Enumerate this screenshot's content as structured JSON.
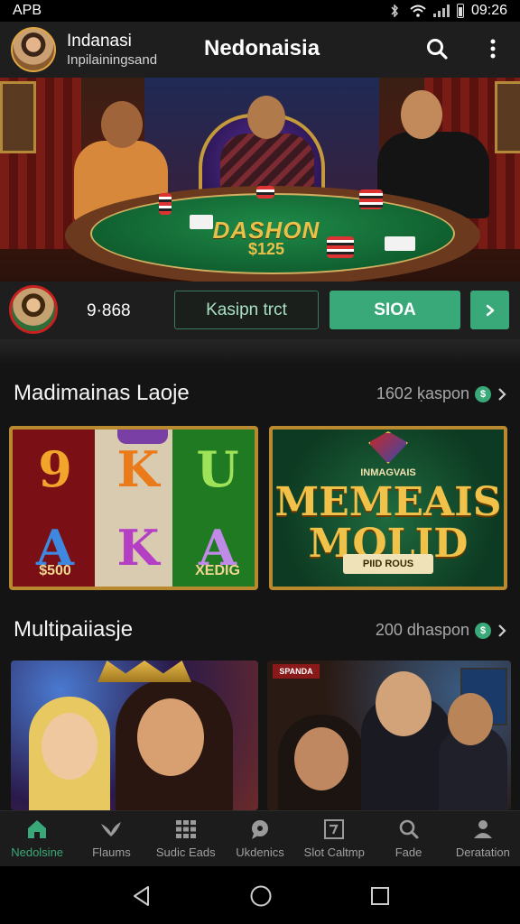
{
  "status": {
    "carrier": "APB",
    "time": "09:26"
  },
  "header": {
    "user_name": "Indanasi",
    "user_sub": "Inpilainingsand",
    "title": "Nedonaisia",
    "icons": [
      "search-icon",
      "more-vert-icon"
    ]
  },
  "hero": {
    "table_text": "DASHON",
    "table_number": "$125"
  },
  "actions": {
    "balance": "9·868",
    "secondary_label": "Kasipn trct",
    "primary_label": "SIOA",
    "accent": "#3aa979"
  },
  "sections": [
    {
      "title": "Madimainas Laoje",
      "meta": "1602 ḳaspon",
      "tiles": [
        {
          "type": "slot",
          "reels": [
            {
              "top": "9",
              "bottom": "A",
              "foot": "$500"
            },
            {
              "top": "K",
              "bottom": "K",
              "foot": ""
            },
            {
              "top": "U",
              "bottom": "A",
              "foot": "XEDIG"
            }
          ]
        },
        {
          "type": "title",
          "kicker": "INMAGVAIS",
          "main_line1": "MEMEAIS",
          "main_line2": "MOLID",
          "sub": "PIID ROUS"
        }
      ]
    },
    {
      "title": "Multipaiiasje",
      "meta": "200 dhaspon",
      "tiles": [
        {
          "type": "photo",
          "name": "two-women-photo"
        },
        {
          "type": "photo",
          "name": "group-photo",
          "sign": "SPANDA"
        }
      ]
    }
  ],
  "bottom_nav": [
    {
      "label": "Nedolsine",
      "icon": "home-icon",
      "active": true
    },
    {
      "label": "Flaums",
      "icon": "bird-icon",
      "active": false
    },
    {
      "label": "Sudic Eads",
      "icon": "grid-icon",
      "active": false
    },
    {
      "label": "Ukdenics",
      "icon": "chat-icon",
      "active": false
    },
    {
      "label": "Slot Caltmp",
      "icon": "slot-icon",
      "active": false
    },
    {
      "label": "Fade",
      "icon": "search-icon",
      "active": false
    },
    {
      "label": "Deratation",
      "icon": "person-icon",
      "active": false
    }
  ]
}
